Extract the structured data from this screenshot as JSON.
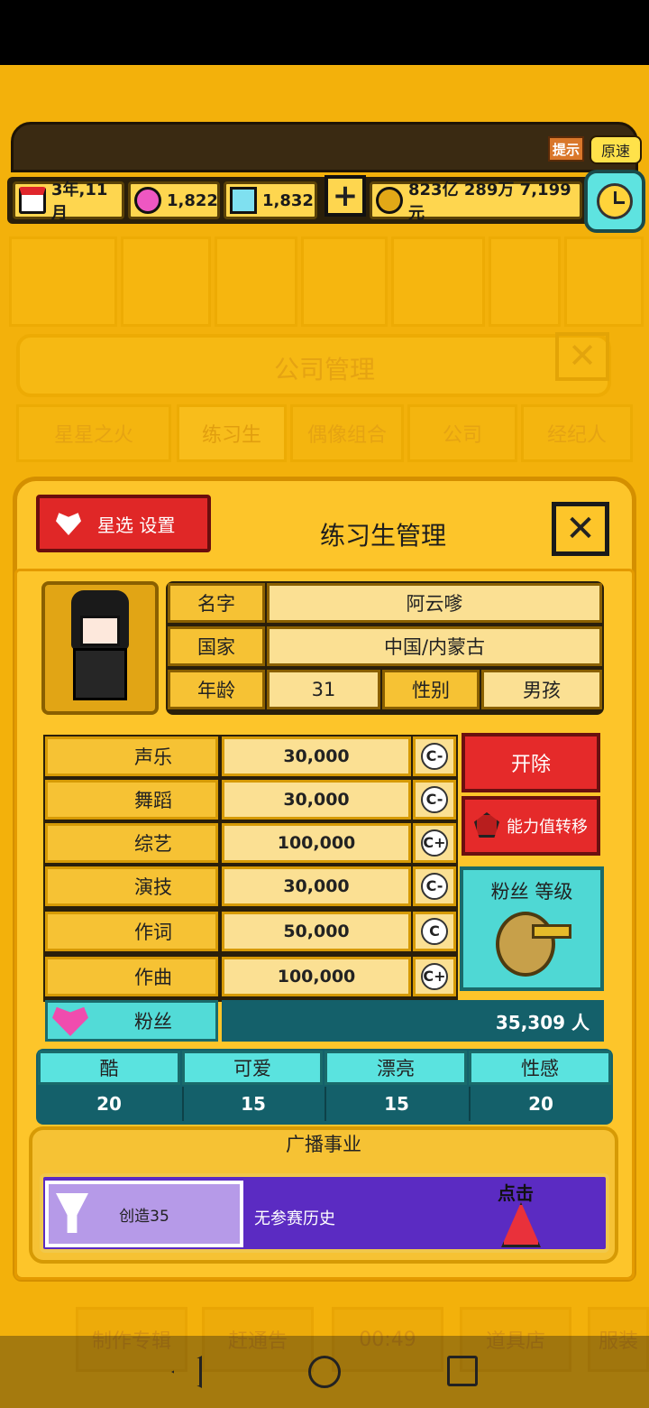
{
  "topbar": {
    "hint_label": "提示",
    "speed_label": "原速"
  },
  "resources": {
    "date": "3年,11月",
    "pink_gems": "1,822",
    "diamonds": "1,832",
    "money": "823亿 289万 7,199元"
  },
  "background_panel": {
    "title": "公司管理",
    "tabs": [
      "星星之火",
      "练习生",
      "偶像组合",
      "公司",
      "经纪人"
    ],
    "bottom_buttons": [
      "制作专辑",
      "赶通告",
      "00:49",
      "道具店",
      "服装"
    ]
  },
  "panel": {
    "star_select_label": "星选 设置",
    "title": "练习生管理"
  },
  "trainee": {
    "name_label": "名字",
    "name": "阿云嗲",
    "country_label": "国家",
    "country": "中国/内蒙古",
    "age_label": "年龄",
    "age": "31",
    "gender_label": "性别",
    "gender": "男孩"
  },
  "skills": [
    {
      "name": "声乐",
      "value": "30,000",
      "grade": "C-",
      "icon": "microphone-icon"
    },
    {
      "name": "舞蹈",
      "value": "30,000",
      "grade": "C-",
      "icon": "shoe-icon"
    },
    {
      "name": "综艺",
      "value": "100,000",
      "grade": "C+",
      "icon": "variety-icon"
    },
    {
      "name": "演技",
      "value": "30,000",
      "grade": "C-",
      "icon": "camera-icon"
    },
    {
      "name": "作词",
      "value": "50,000",
      "grade": "C",
      "icon": "pen-icon"
    },
    {
      "name": "作曲",
      "value": "100,000",
      "grade": "C+",
      "icon": "piano-icon"
    }
  ],
  "fans": {
    "label": "粉丝",
    "value": "35,309 人"
  },
  "actions": {
    "fire_label": "开除",
    "transfer_label": "能力值转移",
    "fan_level_label": "粉丝 等级"
  },
  "attributes": [
    {
      "name": "酷",
      "value": "20"
    },
    {
      "name": "可爱",
      "value": "15"
    },
    {
      "name": "漂亮",
      "value": "15"
    },
    {
      "name": "性感",
      "value": "20"
    }
  ],
  "broadcast": {
    "title": "广播事业",
    "card_label": "创造35",
    "note": "无参赛历史",
    "click_label": "点击"
  },
  "colors": {
    "background": "#f3b10b",
    "panel": "#fdc52a",
    "red_button": "#e52a2a",
    "teal": "#14606a",
    "cyan": "#52dbd7",
    "purple": "#5b2bc2"
  }
}
